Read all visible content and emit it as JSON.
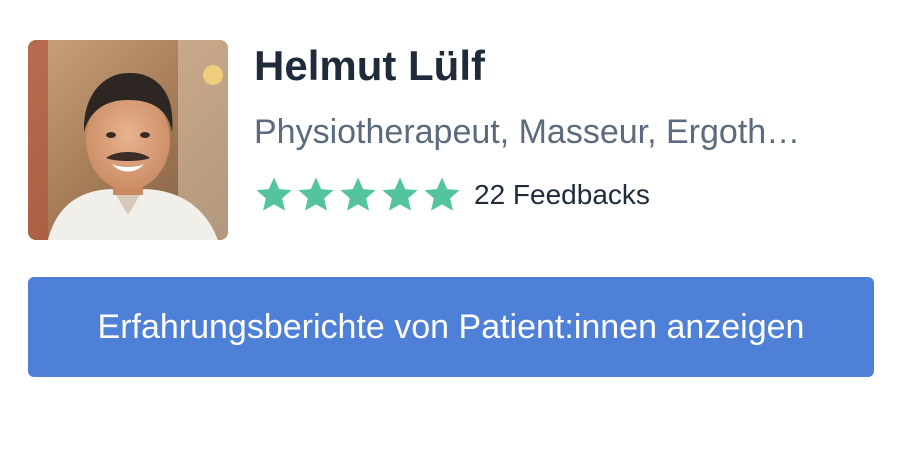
{
  "profile": {
    "name": "Helmut Lülf",
    "profession": "Physiotherapeut, Masseur, Ergoth…",
    "rating": {
      "stars_filled": 5,
      "stars_total": 5,
      "feedback_label": "22 Feedbacks",
      "star_color": "#54c3a0"
    },
    "avatar_icon": "person-photo"
  },
  "actions": {
    "show_reviews_label": "Erfahrungsberichte von Patient:innen anzeigen",
    "button_color": "#4f80d8"
  }
}
